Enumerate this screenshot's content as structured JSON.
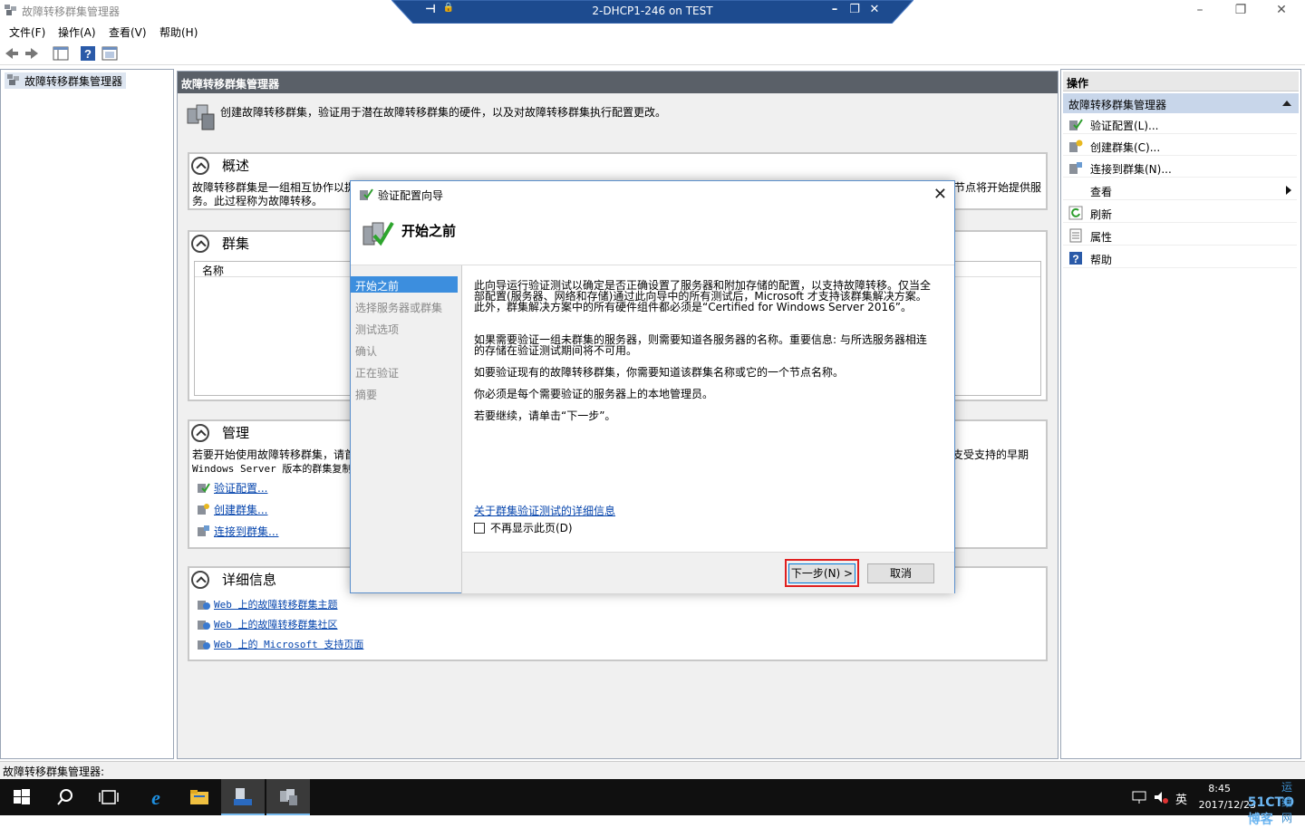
{
  "window": {
    "title": "故障转移群集管理器",
    "controls": [
      "minimize-icon",
      "restore-icon",
      "close-icon"
    ]
  },
  "rdp_bar": {
    "title": "2-DHCP1-246 on TEST",
    "pin_glyph": "⊣",
    "lock_glyph": "🔒",
    "minimize_glyph": "–",
    "restore_glyph": "❐",
    "close_glyph": "✕"
  },
  "menu": [
    "文件(F)",
    "操作(A)",
    "查看(V)",
    "帮助(H)"
  ],
  "tree": {
    "root": "故障转移群集管理器"
  },
  "center": {
    "header": "故障转移群集管理器",
    "intro": "创建故障转移群集，验证用于潜在故障转移群集的硬件，以及对故障转移群集执行配置更改。",
    "overview": {
      "title": "概述",
      "line1_start": "故障转移群集是一组相互协作以提",
      "line1_end": "节点将开始提供服",
      "line2": "务。此过程称为故障转移。"
    },
    "clusters": {
      "title": "群集",
      "column_name": "名称"
    },
    "manage": {
      "title": "管理",
      "line1_start": "若要开始使用故障转移群集，请首",
      "line1_end": "支受支持的早期",
      "line2": "Windows Server 版本的群集复制",
      "links": [
        "验证配置...",
        "创建群集...",
        "连接到群集..."
      ]
    },
    "details": {
      "title": "详细信息",
      "links": [
        "Web 上的故障转移群集主题",
        "Web 上的故障转移群集社区",
        "Web 上的 Microsoft 支持页面"
      ]
    }
  },
  "actions": {
    "header": "操作",
    "group": "故障转移群集管理器",
    "items": [
      "验证配置(L)...",
      "创建群集(C)...",
      "连接到群集(N)...",
      "查看",
      "刷新",
      "属性",
      "帮助"
    ]
  },
  "status_bar": "故障转移群集管理器:",
  "wizard": {
    "title": "验证配置向导",
    "heading": "开始之前",
    "steps": [
      "开始之前",
      "选择服务器或群集",
      "测试选项",
      "确认",
      "正在验证",
      "摘要"
    ],
    "active_step": 0,
    "paragraphs": [
      "此向导运行验证测试以确定是否正确设置了服务器和附加存储的配置，以支持故障转移。仅当全部配置(服务器、网络和存储)通过此向导中的所有测试后，Microsoft 才支持该群集解决方案。此外，群集解决方案中的所有硬件组件都必须是“Certified for Windows Server 2016”。",
      "如果需要验证一组未群集的服务器，则需要知道各服务器的名称。重要信息: 与所选服务器相连的存储在验证测试期间将不可用。",
      "如要验证现有的故障转移群集，你需要知道该群集名称或它的一个节点名称。",
      "你必须是每个需要验证的服务器上的本地管理员。",
      "若要继续，请单击“下一步”。"
    ],
    "link": "关于群集验证测试的详细信息",
    "checkbox_label": "不再显示此页(D)",
    "checkbox_checked": false,
    "next_button": "下一步(N) >",
    "cancel_button": "取消",
    "highlight_color": "#e02020"
  },
  "tray": {
    "ime": "英",
    "time": "8:45",
    "date": "2017/12/23",
    "watermark": "51CTO博客",
    "watermark_cn": "运维网"
  }
}
